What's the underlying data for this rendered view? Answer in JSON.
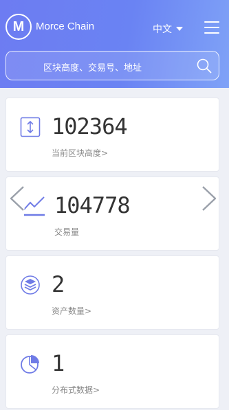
{
  "header": {
    "logo_letter": "M",
    "app_name": "Morce Chain",
    "language": "中文"
  },
  "search": {
    "placeholder": "区块高度、交易号、地址"
  },
  "stats": [
    {
      "icon": "block-height-icon",
      "value": "102364",
      "label": "当前区块高度>"
    },
    {
      "icon": "trend-chart-icon",
      "value": "104778",
      "label": "交易量"
    },
    {
      "icon": "asset-stack-icon",
      "value": "2",
      "label": "资产数量>"
    },
    {
      "icon": "pie-chart-icon",
      "value": "1",
      "label": "分布式数据>"
    }
  ],
  "colors": {
    "header_start": "#6d7cf2",
    "header_end": "#7fa2f7",
    "icon_accent": "#6f7be6",
    "background": "#eef0f6"
  }
}
